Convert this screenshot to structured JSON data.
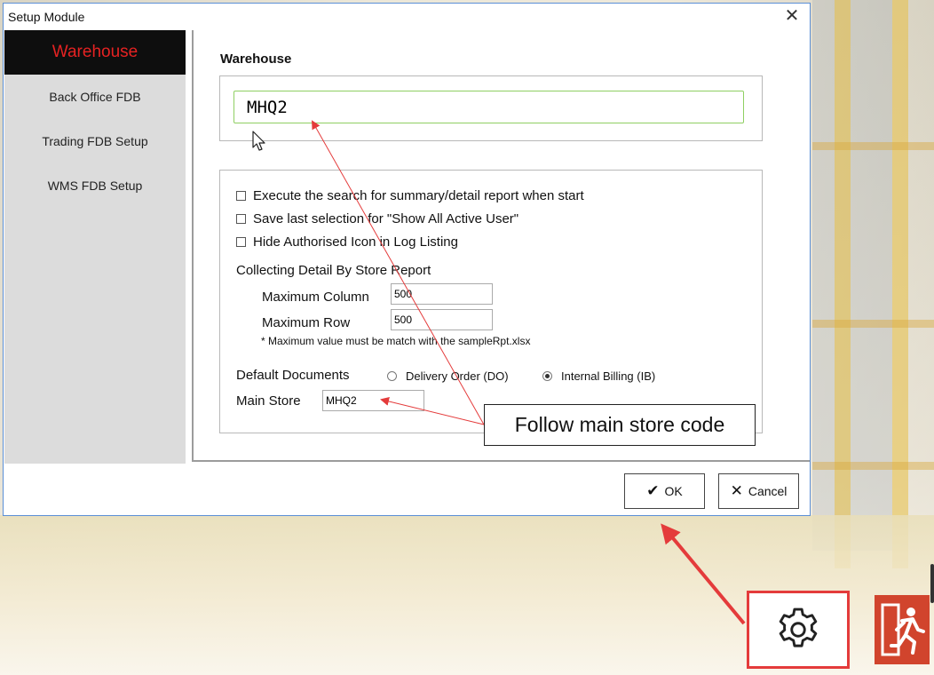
{
  "window": {
    "title": "Setup Module",
    "close_glyph": "✕"
  },
  "sidebar": {
    "items": [
      {
        "label": "Warehouse",
        "active": true
      },
      {
        "label": "Back Office FDB"
      },
      {
        "label": "Trading FDB Setup"
      },
      {
        "label": "WMS FDB Setup"
      }
    ]
  },
  "warehouse": {
    "section_title": "Warehouse",
    "value": "MHQ2"
  },
  "options": {
    "checkboxes": [
      {
        "label": "Execute the search for summary/detail report when start",
        "checked": false
      },
      {
        "label": "Save last selection for \"Show All Active User\"",
        "checked": false
      },
      {
        "label": "Hide Authorised Icon in Log Listing",
        "checked": false
      }
    ],
    "collecting_title": "Collecting Detail By Store Report",
    "max_column_label": "Maximum Column",
    "max_column_value": "500",
    "max_row_label": "Maximum Row",
    "max_row_value": "500",
    "note": "* Maximum value must be match with the sampleRpt.xlsx",
    "default_documents_label": "Default Documents",
    "radio_do_label": "Delivery Order (DO)",
    "radio_ib_label": "Internal Billing (IB)",
    "selected_document": "Internal Billing (IB)",
    "main_store_label": "Main Store",
    "main_store_value": "MHQ2"
  },
  "buttons": {
    "ok_label": "OK",
    "cancel_label": "Cancel"
  },
  "annotation": {
    "callout_text": "Follow main store code",
    "color": "#e43b3b"
  },
  "icons": {
    "settings": "gear-icon",
    "exit": "exit-icon",
    "ok": "checkmark-icon",
    "cancel": "cross-icon"
  }
}
